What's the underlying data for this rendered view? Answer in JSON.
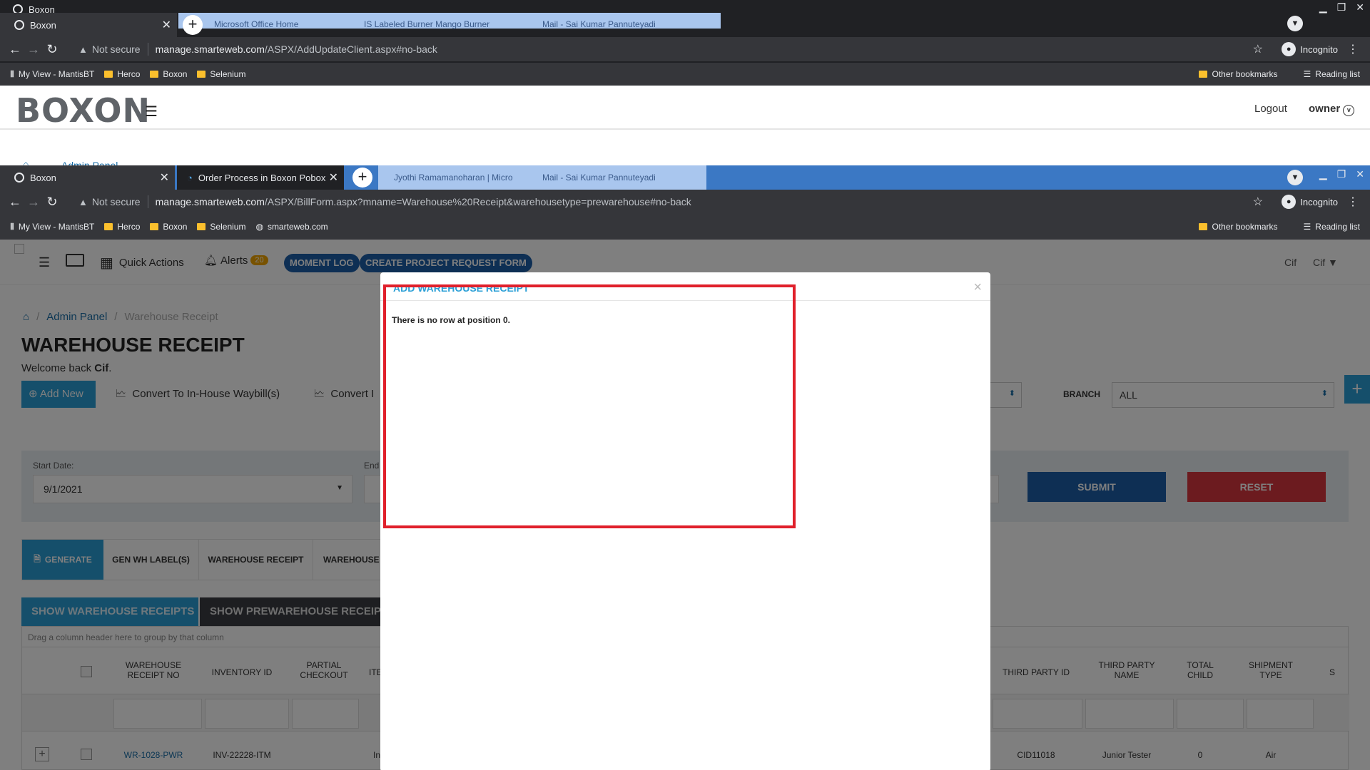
{
  "window1": {
    "behind_tab": "Boxon",
    "active_tab": "Boxon",
    "bg_tabs": [
      "Microsoft Office Home",
      "IS Labeled Burner Mango Burner",
      "Mail - Sai Kumar Pannuteyadi"
    ],
    "not_secure": "Not secure",
    "url_host": "manage.smarteweb.com",
    "url_path": "/ASPX/AddUpdateClient.aspx#no-back",
    "incognito": "Incognito",
    "bookmarks": [
      "My View - MantisBT",
      "Herco",
      "Boxon",
      "Selenium"
    ],
    "other_bookmarks": "Other bookmarks",
    "reading_list": "Reading list",
    "logo": "BOXON",
    "logout": "Logout",
    "user": "owner",
    "partial_breadcrumb": "Admin Panel"
  },
  "window2": {
    "tab1": "Boxon",
    "tab2": "Order Process in Boxon Pobox Sc",
    "bg_tabs": [
      "Jyothi Ramamanoharan | Micro",
      "Mail - Sai Kumar Pannuteyadi"
    ],
    "not_secure": "Not secure",
    "url_host": "manage.smarteweb.com",
    "url_path": "/ASPX/BillForm.aspx?mname=Warehouse%20Receipt&warehousetype=prewarehouse#no-back",
    "incognito": "Incognito",
    "bookmarks": [
      "My View - MantisBT",
      "Herco",
      "Boxon",
      "Selenium",
      "smarteweb.com"
    ],
    "other_bookmarks": "Other bookmarks",
    "reading_list": "Reading list"
  },
  "app": {
    "quick_actions": "Quick Actions",
    "alerts": "Alerts",
    "alerts_count": "20",
    "moment_log": "MOMENT LOG",
    "create_request": "CREATE PROJECT REQUEST FORM",
    "user_short": "Cif",
    "user_menu": "Cif",
    "breadcrumb": [
      "Admin Panel",
      "Warehouse Receipt"
    ],
    "page_title": "WAREHOUSE RECEIPT",
    "welcome_prefix": "Welcome back ",
    "welcome_user": "Cif",
    "welcome_suffix": ".",
    "add_new": "Add New",
    "convert_inhouse": "Convert To In-House Waybill(s)",
    "convert_other": "Convert I",
    "branch_label": "BRANCH",
    "branch_value": "ALL",
    "start_date_label": "Start Date:",
    "start_date_value": "9/1/2021",
    "end_label": "End",
    "submit": "SUBMIT",
    "reset": "RESET",
    "tabs": [
      "GENERATE",
      "GEN WH LABEL(S)",
      "WAREHOUSE RECEIPT",
      "WAREHOUSE"
    ],
    "subtabs": [
      "SHOW WAREHOUSE RECEIPTS",
      "SHOW PREWAREHOUSE RECEIPT"
    ],
    "drag_hint": "Drag a column header here to group by that column",
    "columns_left": [
      "WAREHOUSE RECEIPT NO",
      "INVENTORY ID",
      "PARTIAL CHECKOUT",
      "ITE"
    ],
    "columns_right": [
      "THIRD PARTY ID",
      "THIRD PARTY NAME",
      "TOTAL CHILD",
      "SHIPMENT TYPE",
      "S"
    ],
    "row": {
      "wr_no": "WR-1028-PWR",
      "inventory": "INV-22228-ITM",
      "item": "In",
      "third_party_id": "CID11018",
      "third_party_name": "Junior Tester",
      "total_child": "0",
      "shipment_type": "Air"
    }
  },
  "modal": {
    "title": "ADD WAREHOUSE RECEIPT",
    "close": "×",
    "message": "There is no row at position 0."
  }
}
